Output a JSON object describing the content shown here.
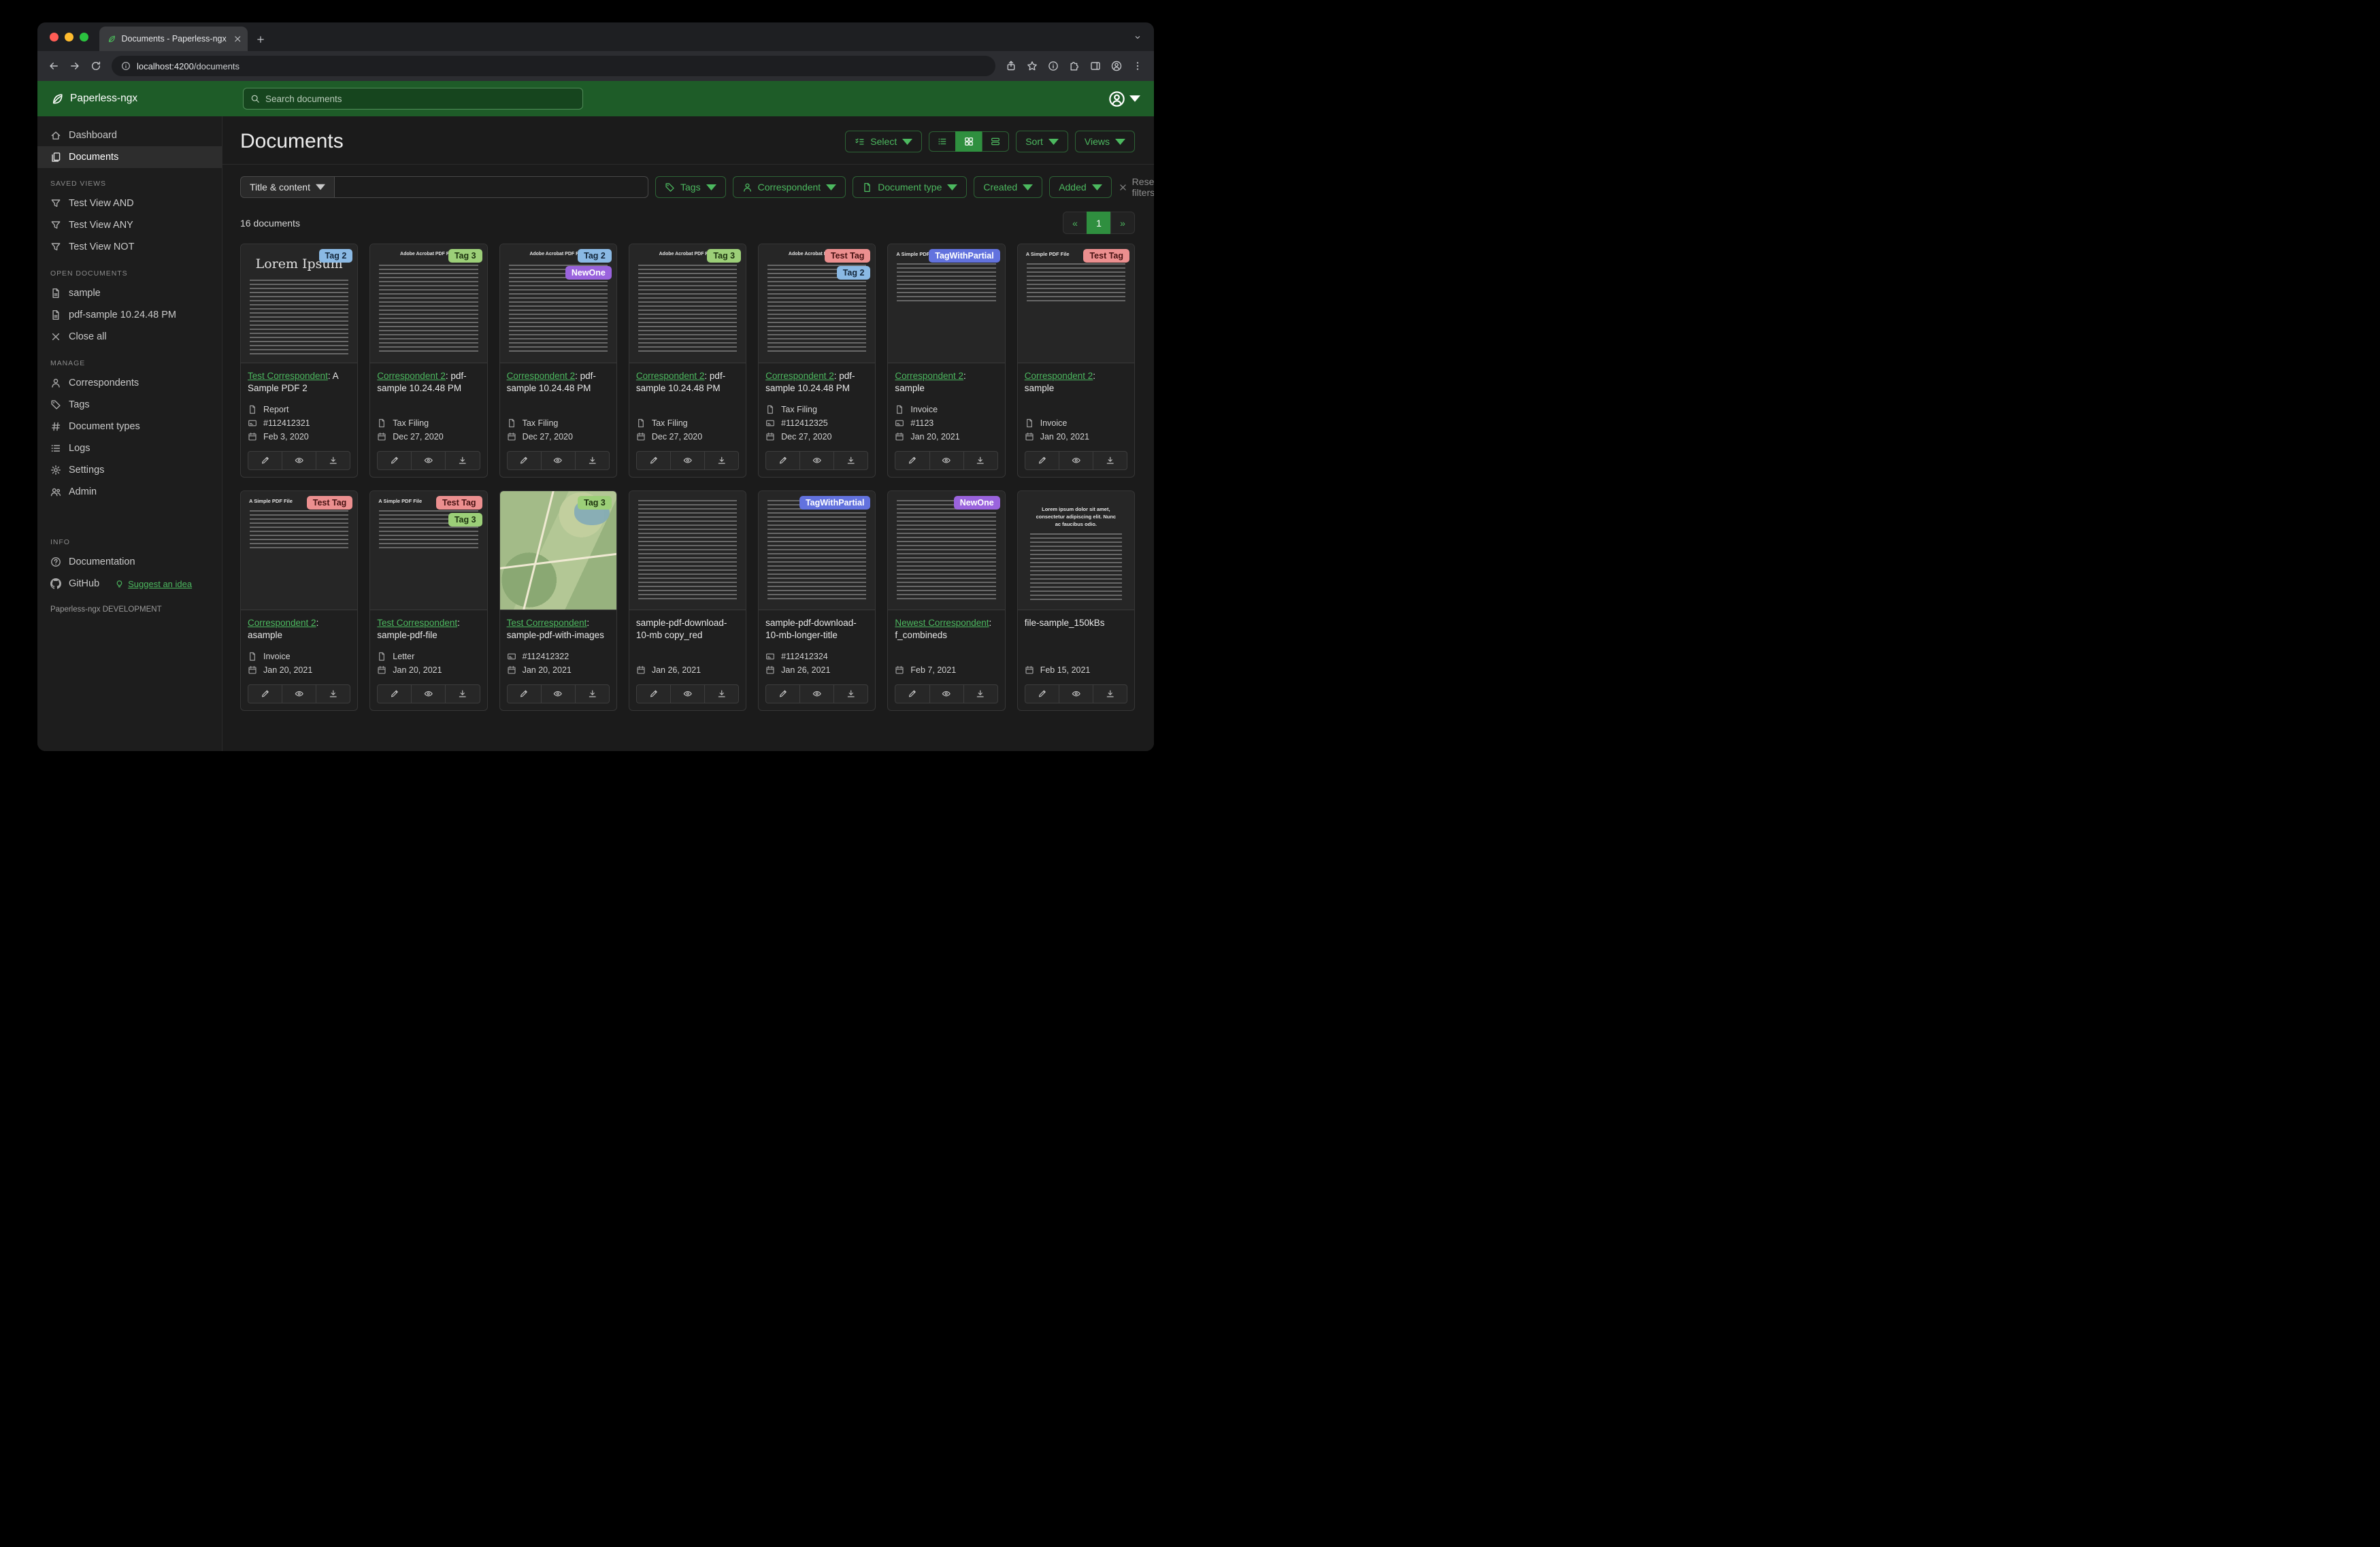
{
  "colors": {
    "brand_green": "#1e5c28",
    "accent_green": "#4cb85f",
    "active_green": "#2f8f3f"
  },
  "browser": {
    "tab_title": "Documents - Paperless-ngx",
    "url_host": "localhost:4200",
    "url_path": "/documents"
  },
  "header": {
    "app_name": "Paperless-ngx",
    "search_placeholder": "Search documents"
  },
  "sidebar": {
    "items": [
      {
        "label": "Dashboard",
        "icon": "house-icon",
        "active": false
      },
      {
        "label": "Documents",
        "icon": "documents-icon",
        "active": true
      }
    ],
    "sections": [
      {
        "title": "SAVED VIEWS",
        "items": [
          {
            "label": "Test View AND",
            "icon": "funnel-icon"
          },
          {
            "label": "Test View ANY",
            "icon": "funnel-icon"
          },
          {
            "label": "Test View NOT",
            "icon": "funnel-icon"
          }
        ]
      },
      {
        "title": "OPEN DOCUMENTS",
        "items": [
          {
            "label": "sample",
            "icon": "file-text-icon"
          },
          {
            "label": "pdf-sample 10.24.48 PM",
            "icon": "file-text-icon"
          },
          {
            "label": "Close all",
            "icon": "close-icon"
          }
        ]
      },
      {
        "title": "MANAGE",
        "items": [
          {
            "label": "Correspondents",
            "icon": "person-icon"
          },
          {
            "label": "Tags",
            "icon": "tag-icon"
          },
          {
            "label": "Document types",
            "icon": "hash-icon"
          },
          {
            "label": "Logs",
            "icon": "list-icon"
          },
          {
            "label": "Settings",
            "icon": "gear-icon"
          },
          {
            "label": "Admin",
            "icon": "people-icon"
          }
        ]
      },
      {
        "title": "INFO",
        "items": [
          {
            "label": "Documentation",
            "icon": "question-icon"
          },
          {
            "label": "GitHub",
            "icon": "github-icon",
            "extra_link": {
              "label": "Suggest an idea",
              "icon": "bulb-icon"
            }
          }
        ]
      }
    ],
    "footer": "Paperless-ngx DEVELOPMENT"
  },
  "toolbar": {
    "title": "Documents",
    "select_label": "Select",
    "sort_label": "Sort",
    "views_label": "Views"
  },
  "filters": {
    "field_selector": "Title & content",
    "query_value": "",
    "buttons": [
      {
        "label": "Tags",
        "icon": "tag-icon"
      },
      {
        "label": "Correspondent",
        "icon": "person-icon"
      },
      {
        "label": "Document type",
        "icon": "file-icon"
      },
      {
        "label": "Created"
      },
      {
        "label": "Added"
      }
    ],
    "reset_label": "Reset filters"
  },
  "results": {
    "count_text": "16 documents",
    "pagination": {
      "prev": "«",
      "current": "1",
      "next": "»"
    }
  },
  "card_actions": [
    {
      "name": "edit-button",
      "icon": "pencil-icon"
    },
    {
      "name": "preview-button",
      "icon": "eye-icon"
    },
    {
      "name": "download-button",
      "icon": "download-icon"
    }
  ],
  "documents": [
    {
      "tags": [
        {
          "label": "Tag 2",
          "bg": "#8ab9e4",
          "fg": "#14273b"
        }
      ],
      "correspondent": "Test Correspondent",
      "title": ": A Sample PDF 2",
      "meta": [
        {
          "icon": "file-icon",
          "text": "Report"
        },
        {
          "icon": "card-icon",
          "text": "#112412321"
        },
        {
          "icon": "calendar-icon",
          "text": "Feb 3, 2020"
        }
      ],
      "thumb": {
        "kind": "lorem",
        "heading": "Lorem Ipsum"
      }
    },
    {
      "tags": [
        {
          "label": "Tag 3",
          "bg": "#9ccf78",
          "fg": "#1d330f"
        }
      ],
      "correspondent": "Correspondent 2",
      "title": ": pdf-sample 10.24.48 PM",
      "meta": [
        {
          "icon": "file-icon",
          "text": "Tax Filing"
        },
        {
          "icon": "calendar-icon",
          "text": "Dec 27, 2020"
        }
      ],
      "thumb": {
        "kind": "acrobat",
        "heading": "Adobe Acrobat PDF Files"
      }
    },
    {
      "tags": [
        {
          "label": "Tag 2",
          "bg": "#8ab9e4",
          "fg": "#14273b"
        },
        {
          "label": "NewOne",
          "bg": "#9a63dd",
          "fg": "#ffffff"
        }
      ],
      "correspondent": "Correspondent 2",
      "title": ": pdf-sample 10.24.48 PM",
      "meta": [
        {
          "icon": "file-icon",
          "text": "Tax Filing"
        },
        {
          "icon": "calendar-icon",
          "text": "Dec 27, 2020"
        }
      ],
      "thumb": {
        "kind": "acrobat",
        "heading": "Adobe Acrobat PDF Files"
      }
    },
    {
      "tags": [
        {
          "label": "Tag 3",
          "bg": "#9ccf78",
          "fg": "#1d330f"
        }
      ],
      "correspondent": "Correspondent 2",
      "title": ": pdf-sample 10.24.48 PM",
      "meta": [
        {
          "icon": "file-icon",
          "text": "Tax Filing"
        },
        {
          "icon": "calendar-icon",
          "text": "Dec 27, 2020"
        }
      ],
      "thumb": {
        "kind": "acrobat",
        "heading": "Adobe Acrobat PDF Files"
      }
    },
    {
      "tags": [
        {
          "label": "Test Tag",
          "bg": "#ec8f8f",
          "fg": "#471212"
        },
        {
          "label": "Tag 2",
          "bg": "#8ab9e4",
          "fg": "#14273b"
        }
      ],
      "correspondent": "Correspondent 2",
      "title": ": pdf-sample 10.24.48 PM",
      "meta": [
        {
          "icon": "file-icon",
          "text": "Tax Filing"
        },
        {
          "icon": "card-icon",
          "text": "#112412325"
        },
        {
          "icon": "calendar-icon",
          "text": "Dec 27, 2020"
        }
      ],
      "thumb": {
        "kind": "acrobat",
        "heading": "Adobe Acrobat PDF Files"
      }
    },
    {
      "tags": [
        {
          "label": "TagWithPartial",
          "bg": "#6272de",
          "fg": "#ffffff"
        }
      ],
      "correspondent": "Correspondent 2",
      "title": ": sample",
      "meta": [
        {
          "icon": "file-icon",
          "text": "Invoice"
        },
        {
          "icon": "card-icon",
          "text": "#1123"
        },
        {
          "icon": "calendar-icon",
          "text": "Jan 20, 2021"
        }
      ],
      "thumb": {
        "kind": "simple",
        "heading": "A Simple PDF File"
      }
    },
    {
      "tags": [
        {
          "label": "Test Tag",
          "bg": "#ec8f8f",
          "fg": "#471212"
        }
      ],
      "correspondent": "Correspondent 2",
      "title": ": sample",
      "meta": [
        {
          "icon": "file-icon",
          "text": "Invoice"
        },
        {
          "icon": "calendar-icon",
          "text": "Jan 20, 2021"
        }
      ],
      "thumb": {
        "kind": "simple",
        "heading": "A Simple PDF File"
      }
    },
    {
      "tags": [
        {
          "label": "Test Tag",
          "bg": "#ec8f8f",
          "fg": "#471212"
        }
      ],
      "correspondent": "Correspondent 2",
      "title": ": asample",
      "meta": [
        {
          "icon": "file-icon",
          "text": "Invoice"
        },
        {
          "icon": "calendar-icon",
          "text": "Jan 20, 2021"
        }
      ],
      "thumb": {
        "kind": "simple",
        "heading": "A Simple PDF File"
      }
    },
    {
      "tags": [
        {
          "label": "Test Tag",
          "bg": "#ec8f8f",
          "fg": "#471212"
        },
        {
          "label": "Tag 3",
          "bg": "#9ccf78",
          "fg": "#1d330f"
        }
      ],
      "correspondent": "Test Correspondent",
      "title": ": sample-pdf-file",
      "meta": [
        {
          "icon": "file-icon",
          "text": "Letter"
        },
        {
          "icon": "calendar-icon",
          "text": "Jan 20, 2021"
        }
      ],
      "thumb": {
        "kind": "simple",
        "heading": "A Simple PDF File"
      }
    },
    {
      "tags": [
        {
          "label": "Tag 3",
          "bg": "#9ccf78",
          "fg": "#1d330f"
        }
      ],
      "correspondent": "Test Correspondent",
      "title": ": sample-pdf-with-images",
      "meta": [
        {
          "icon": "card-icon",
          "text": "#112412322"
        },
        {
          "icon": "calendar-icon",
          "text": "Jan 20, 2021"
        }
      ],
      "thumb": {
        "kind": "map"
      }
    },
    {
      "tags": [],
      "correspondent": null,
      "title": "sample-pdf-download-10-mb copy_red",
      "meta": [
        {
          "icon": "calendar-icon",
          "text": "Jan 26, 2021"
        }
      ],
      "thumb": {
        "kind": "dense"
      }
    },
    {
      "tags": [
        {
          "label": "TagWithPartial",
          "bg": "#6272de",
          "fg": "#ffffff"
        }
      ],
      "correspondent": null,
      "title": "sample-pdf-download-10-mb-longer-title",
      "meta": [
        {
          "icon": "card-icon",
          "text": "#112412324"
        },
        {
          "icon": "calendar-icon",
          "text": "Jan 26, 2021"
        }
      ],
      "thumb": {
        "kind": "dense"
      }
    },
    {
      "tags": [
        {
          "label": "NewOne",
          "bg": "#9a63dd",
          "fg": "#ffffff"
        }
      ],
      "correspondent": "Newest Correspondent",
      "title": ": f_combineds",
      "meta": [
        {
          "icon": "calendar-icon",
          "text": "Feb 7, 2021"
        }
      ],
      "thumb": {
        "kind": "dense"
      }
    },
    {
      "tags": [],
      "correspondent": null,
      "title": "file-sample_150kBs",
      "meta": [
        {
          "icon": "calendar-icon",
          "text": "Feb 15, 2021"
        }
      ],
      "thumb": {
        "kind": "lorem-center",
        "heading": "Lorem ipsum dolor sit amet, consectetur adipiscing elit. Nunc ac faucibus odio."
      }
    }
  ]
}
